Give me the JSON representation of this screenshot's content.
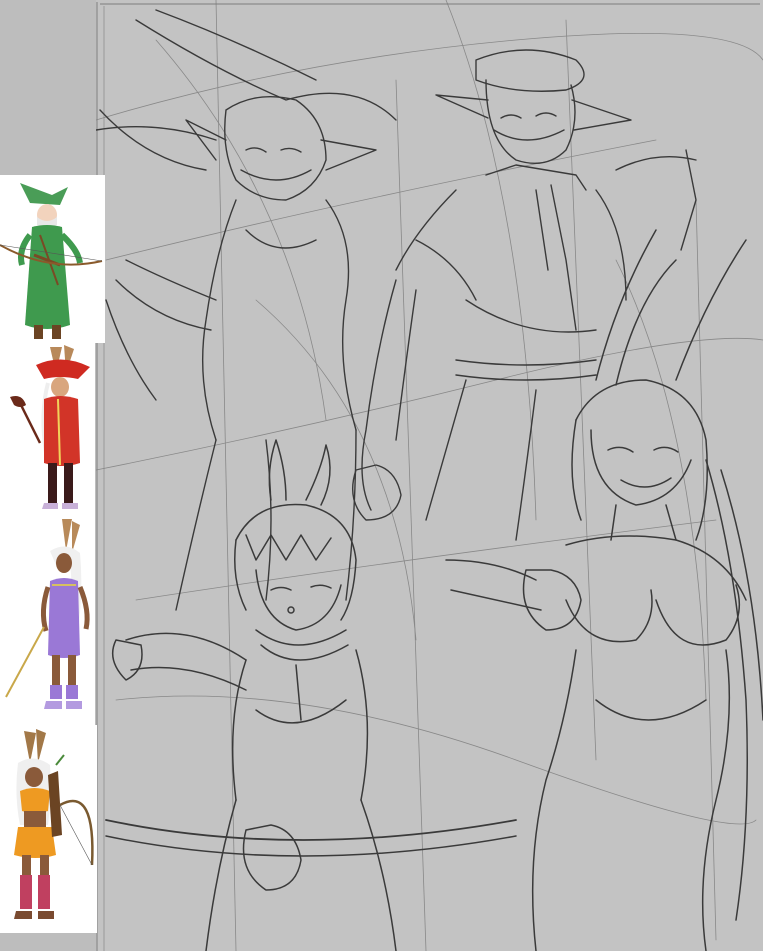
{
  "canvas": {
    "background_color": "#bdbdbd",
    "sketch_area_color": "#c3c3c3",
    "line_color": "#2b2b2b",
    "frame_color": "#8a8a8a"
  },
  "reference_panels": [
    {
      "subject": "elf-archer-green-robe-reference",
      "main_color": "#3f9a4e"
    },
    {
      "subject": "red-mage-bunny-reference",
      "main_color": "#d23428"
    },
    {
      "subject": "purple-dress-viera-rapier-reference",
      "main_color": "#9a78d6"
    },
    {
      "subject": "orange-outfit-viera-archer-reference",
      "main_color": "#ee9a22"
    }
  ],
  "sketch_figures": [
    {
      "subject": "hooded-masked-elf-archer-sketch"
    },
    {
      "subject": "tall-masked-elf-with-cap-sketch"
    },
    {
      "subject": "bunny-eared-girl-with-scarf-and-bow-sketch"
    },
    {
      "subject": "smiling-long-haired-viera-sketch"
    }
  ]
}
